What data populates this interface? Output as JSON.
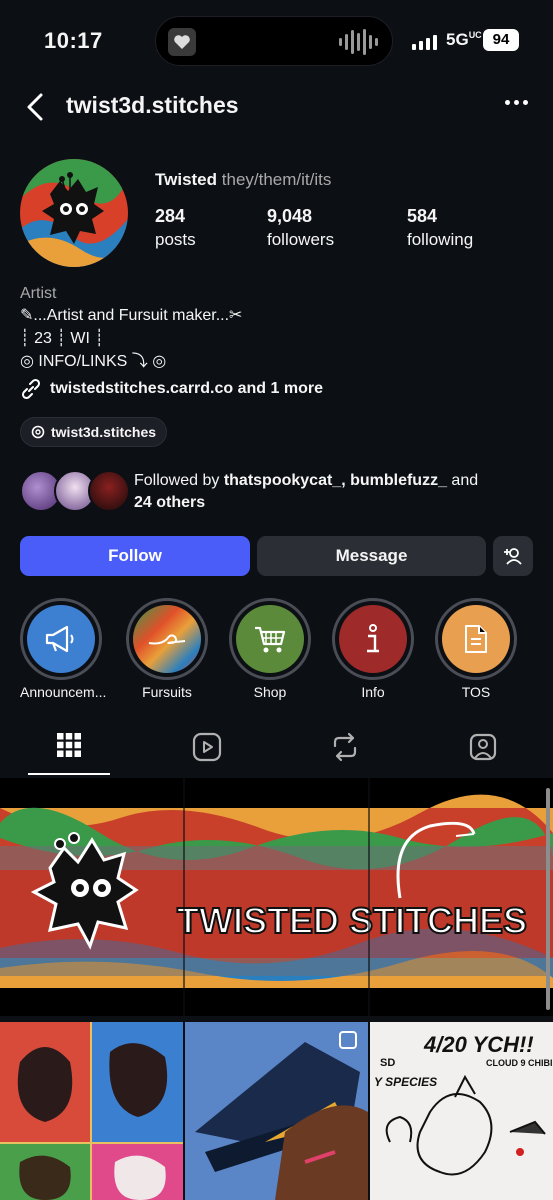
{
  "status_bar": {
    "time": "10:17",
    "network": "5G",
    "network_sub": "UC",
    "battery": "94"
  },
  "header": {
    "username": "twist3d.stitches"
  },
  "profile": {
    "display_name": "Twisted",
    "pronouns": "they/them/it/its",
    "stats": [
      {
        "value": "284",
        "label": "posts"
      },
      {
        "value": "9,048",
        "label": "followers"
      },
      {
        "value": "584",
        "label": "following"
      }
    ],
    "category": "Artist",
    "bio_lines": [
      "✎...Artist and Fursuit maker...✂",
      "┊ 23 ┊ WI ┊",
      "◎ INFO/LINKS ⤵ ◎"
    ],
    "link": "twistedstitches.carrd.co and 1 more",
    "threads_handle": "twist3d.stitches"
  },
  "followed_by": {
    "prefix": "Followed by ",
    "names": "thatspookycat_, bumblefuzz_",
    "joiner": " and ",
    "others": "24 others"
  },
  "actions": {
    "follow": "Follow",
    "message": "Message"
  },
  "highlights": [
    {
      "label": "Announcem...",
      "icon": "megaphone-icon",
      "color": "#3d7fd0"
    },
    {
      "label": "Fursuits",
      "icon": "thread-swirl-icon",
      "color": "#e0502a"
    },
    {
      "label": "Shop",
      "icon": "shopping-cart-icon",
      "color": "#5a8a3a"
    },
    {
      "label": "Info",
      "icon": "info-icon",
      "color": "#9e2a2a"
    },
    {
      "label": "TOS",
      "icon": "document-icon",
      "color": "#e8a050"
    }
  ],
  "tabs": [
    {
      "name": "grid-icon",
      "active": true
    },
    {
      "name": "reels-icon",
      "active": false
    },
    {
      "name": "reposts-icon",
      "active": false
    },
    {
      "name": "tagged-icon",
      "active": false
    }
  ],
  "grid": {
    "banner_text": "TWISTED STITCHES",
    "post_ych_title": "4/20 YCH!!",
    "post_ych_sd": "SD",
    "post_ych_cloud": "CLOUD 9 CHIBI",
    "post_ych_species": "Y SPECIES"
  }
}
